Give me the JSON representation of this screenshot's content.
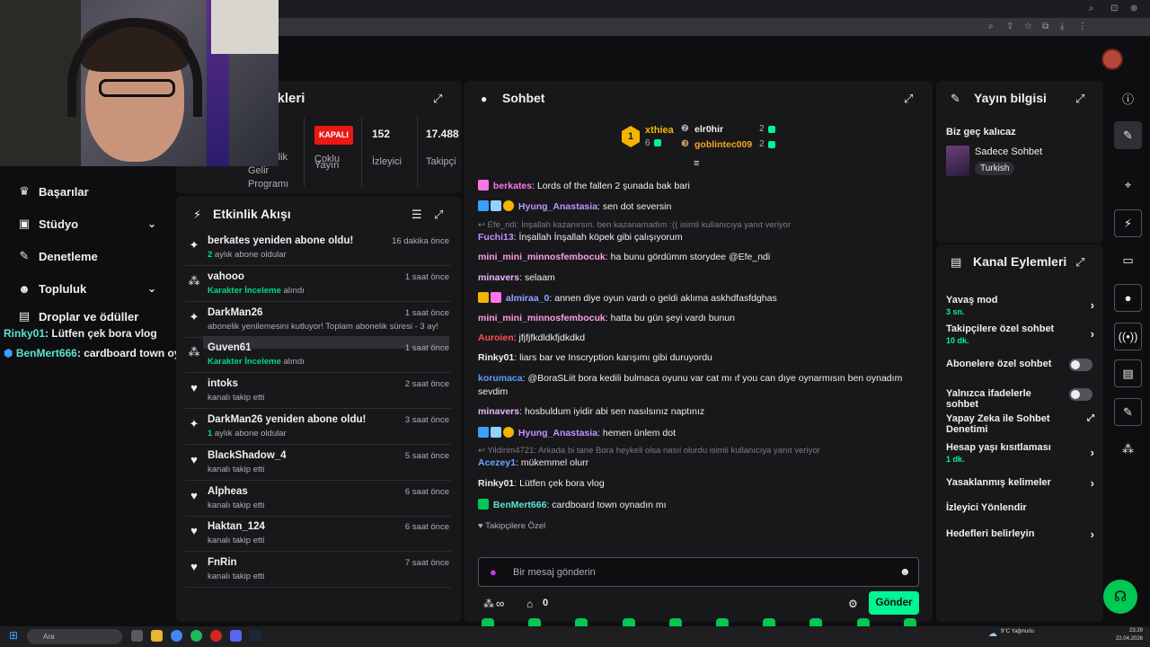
{
  "stats": {
    "title_partial": "stikleri",
    "partner_label_1": "rlik",
    "partner_label_2": "Gelir",
    "partner_label_3": "Programı",
    "multistream_badge": "KAPALI",
    "multistream_label_1": "Çoklu",
    "multistream_label_2": "Yayın",
    "viewers_value": "152",
    "viewers_label": "İzleyici",
    "followers_value": "17.488",
    "followers_label": "Takipçi"
  },
  "nav": {
    "items": [
      {
        "label": "Başarılar",
        "icon": "trophy-icon"
      },
      {
        "label": "Stüdyo",
        "icon": "studio-icon"
      },
      {
        "label": "Denetleme",
        "icon": "wrench-icon"
      },
      {
        "label": "Topluluk",
        "icon": "people-icon"
      },
      {
        "label": "Droplar ve ödüller",
        "icon": "gift-icon"
      }
    ]
  },
  "overlay_chat": [
    {
      "user": "Rinky01",
      "text": ": Lütfen çek bora vlog",
      "color": "#efeff1"
    },
    {
      "user": "BenMert666",
      "text": ": cardboard town oynadın mı",
      "color": "#5be3d1"
    }
  ],
  "activity": {
    "title": "Etkinlik Akışı",
    "items": [
      {
        "name": "berkates yeniden abone oldu!",
        "sub_hl": "2",
        "sub": " aylık abone oldular",
        "time": "16 dakika önce",
        "icon": "sparkle-icon"
      },
      {
        "name": "vahooo",
        "sub_hl": "Karakter İnceleme",
        "sub": " alındı",
        "time": "1 saat önce",
        "icon": "points-icon"
      },
      {
        "name": "DarkMan26",
        "sub_hl": "",
        "sub": "abonelik yenilemesini kutluyor! Toplam abonelik süresi - 3 ay!",
        "time": "1 saat önce",
        "icon": "sparkle-icon"
      },
      {
        "name": "Guven61",
        "sub_hl": "Karakter İnceleme",
        "sub": " alındı",
        "time": "1 saat önce",
        "icon": "points-icon"
      },
      {
        "name": "intoks",
        "sub_hl": "",
        "sub": "kanalı takip etti",
        "time": "2 saat önce",
        "icon": "heart-icon"
      },
      {
        "name": "DarkMan26 yeniden abone oldu!",
        "sub_hl": "1",
        "sub": " aylık abone oldular",
        "time": "3 saat önce",
        "icon": "sparkle-icon"
      },
      {
        "name": "BlackShadow_4",
        "sub_hl": "",
        "sub": "kanalı takip etti",
        "time": "5 saat önce",
        "icon": "heart-icon"
      },
      {
        "name": "Alpheas",
        "sub_hl": "",
        "sub": "kanalı takip etti",
        "time": "6 saat önce",
        "icon": "heart-icon"
      },
      {
        "name": "Haktan_124",
        "sub_hl": "",
        "sub": "kanalı takip etti",
        "time": "6 saat önce",
        "icon": "heart-icon"
      },
      {
        "name": "FnRin",
        "sub_hl": "",
        "sub": "kanalı takip etti",
        "time": "7 saat önce",
        "icon": "heart-icon"
      }
    ]
  },
  "chat": {
    "title": "Sohbet",
    "leaderboard": {
      "first_name": "xthiea",
      "first_count": "6",
      "second_name": "elr0hir",
      "second_count": "2",
      "third_name": "goblintec009",
      "third_count": "2"
    },
    "messages": [
      {
        "user": "berkates",
        "color": "#ff75e6",
        "text": ": Lords of the fallen 2 şunada bak bari"
      },
      {
        "user": "Hyung_Anastasia",
        "color": "#bf94ff",
        "text": ": sen dot seversin"
      },
      {
        "reply": "Efe_ndi: İnşallah kazanırsın. ben kazanamadım :(( isimli kullanıcıya yanıt veriyor"
      },
      {
        "user": "Fuchi13",
        "color": "#bf94ff",
        "text": ": İnşallah İnşallah köpek gibi çalışıyorum"
      },
      {
        "user": "mini_mini_minnosfembocuk",
        "color": "#ff9de6",
        "text": ": ha bunu gördümm storydee @Efe_ndi"
      },
      {
        "user": "minavers",
        "color": "#efb5ff",
        "text": ": selaam"
      },
      {
        "user": "almiraa_0",
        "color": "#8fa7ff",
        "text": ": annen diye oyun vardı o geldi aklıma askhdfasfdghas"
      },
      {
        "user": "mini_mini_minnosfembocuk",
        "color": "#ff9de6",
        "text": ": hatta bu gün şeyi vardı bunun"
      },
      {
        "user": "Auroien",
        "color": "#ff4f4f",
        "text": ": jfjfjfkdldkfjdkdkd"
      },
      {
        "user": "Rinky01",
        "color": "#efeff1",
        "text": ": liars bar ve Inscryption karışımı gibi duruyordu"
      },
      {
        "user": "korumaca",
        "color": "#5b9cff",
        "text": ": @BoraSLiit bora kedili bulmaca oyunu var cat mı ıf you can dıye oynarmısın ben oynadım"
      },
      {
        "cont": "sevdim"
      },
      {
        "user": "minavers",
        "color": "#efb5ff",
        "text": ": hosbuldum iyidir abi sen nasılsınız naptınız"
      },
      {
        "user": "Hyung_Anastasia",
        "color": "#bf94ff",
        "text": ": hemen ünlem dot"
      },
      {
        "reply": "Yildirim4721: Arkada bi tane Bora heykeli olsa nasıl olurdu isimli kullanıcıya yanıt veriyor"
      },
      {
        "user": "Acezey1",
        "color": "#6fa3ff",
        "text": ": mükemmel olurr"
      },
      {
        "user": "Rinky01",
        "color": "#efeff1",
        "text": ": Lütfen çek bora vlog"
      },
      {
        "user": "BenMert666",
        "color": "#5be3d1",
        "text": ": cardboard town oynadın mı"
      }
    ],
    "followers_only_label": "Takipçilere Özel",
    "input_placeholder": "Bir mesaj gönderin",
    "points_label": "∞",
    "gift_count": "0",
    "send_label": "Gönder"
  },
  "stream_info": {
    "title": "Yayın bilgisi",
    "stream_title": "Biz geç kalıcaz",
    "category": "Sadece Sohbet",
    "tag": "Turkish"
  },
  "channel_actions": {
    "title": "Kanal Eylemleri",
    "items": [
      {
        "label": "Yavaş mod",
        "sub": "3 sn.",
        "kind": "chevron"
      },
      {
        "label": "Takipçilere özel sohbet",
        "sub": "10 dk.",
        "kind": "chevron"
      },
      {
        "label": "Abonelere özel sohbet",
        "sub": "",
        "kind": "toggle"
      },
      {
        "label": "Yalnızca ifadelerle sohbet",
        "sub": "",
        "kind": "toggle"
      },
      {
        "label": "Yapay Zeka ile Sohbet Denetimi",
        "sub": "",
        "kind": "external"
      },
      {
        "label": "Hesap yaşı kısıtlaması",
        "sub": "1 dk.",
        "kind": "chevron"
      },
      {
        "label": "Yasaklanmış kelimeler",
        "sub": "",
        "kind": "chevron"
      },
      {
        "label": "İzleyici Yönlendir",
        "sub": "",
        "kind": "none"
      },
      {
        "label": "Hedefleri belirleyin",
        "sub": "",
        "kind": "chevron"
      }
    ]
  },
  "taskbar": {
    "search_placeholder": "Ara",
    "weather": "9°C Yağmurlu",
    "time": "23:29",
    "date": "22.04.2026"
  },
  "colors": {
    "accent": "#00f593",
    "panel": "#18181b",
    "bg": "#0e0e10"
  }
}
